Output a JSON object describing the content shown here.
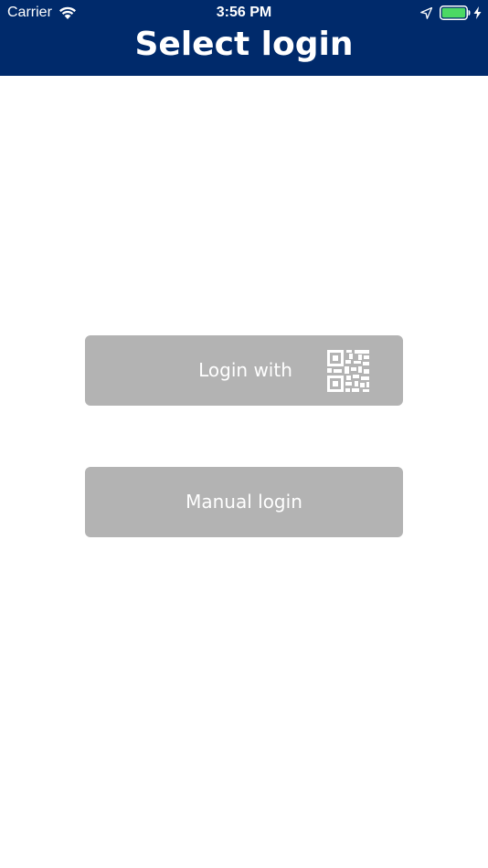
{
  "status_bar": {
    "carrier": "Carrier",
    "time": "3:56 PM",
    "icons": [
      "wifi-icon",
      "location-arrow-icon",
      "battery-icon",
      "charging-bolt-icon"
    ],
    "battery_color": "#4cd964"
  },
  "header": {
    "title": "Select login",
    "background": "#002a6b"
  },
  "buttons": {
    "qr_login_label": "Login with",
    "qr_icon": "qr-code-icon",
    "manual_login_label": "Manual login",
    "background": "#b3b3b3"
  }
}
